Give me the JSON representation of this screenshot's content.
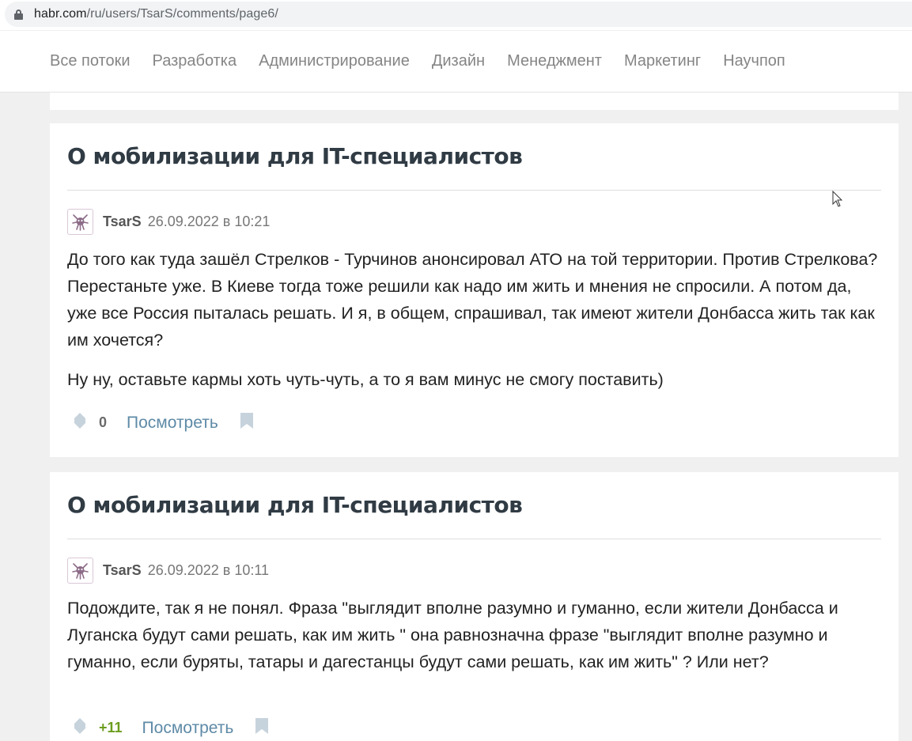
{
  "browser": {
    "url_host": "habr.com",
    "url_path": "/ru/users/TsarS/comments/page6/"
  },
  "nav": {
    "items": [
      "Все потоки",
      "Разработка",
      "Администрирование",
      "Дизайн",
      "Менеджмент",
      "Маркетинг",
      "Научпоп"
    ]
  },
  "comments": [
    {
      "post_title": "О мобилизации для IT-специалистов",
      "author": "TsarS",
      "date": "26.09.2022 в 10:21",
      "paragraphs": [
        "До того как туда зашёл Стрелков - Турчинов анонсировал АТО на той территории. Против Стрелкова? Перестаньте уже. В Киеве тогда тоже решили как надо им жить и мнения не спросили. А потом да, уже все Россия пыталась решать. И я, в общем, спрашивал, так имеют жители Донбасса жить так как им хочется?",
        "Ну ну, оставьте кармы хоть чуть-чуть, а то я вам минус не смогу поставить)"
      ],
      "score": "0",
      "view_label": "Посмотреть"
    },
    {
      "post_title": "О мобилизации для IT-специалистов",
      "author": "TsarS",
      "date": "26.09.2022 в 10:11",
      "paragraphs": [
        "Подождите, так я не понял. Фраза \"выглядит вполне разумно и гуманно, если жители Донбасса и Луганска будут сами решать, как им жить \" она равнозначна фразе \"выглядит вполне разумно и гуманно, если буряты, татары и дагестанцы будут сами решать, как им жить\" ? Или нет?"
      ],
      "score": "+11",
      "view_label": "Посмотреть"
    }
  ],
  "icons": {
    "lock": "lock-icon",
    "avatar": "avatar-icon",
    "vote": "vote-icon",
    "bookmark": "bookmark-icon",
    "cursor": "mouse-cursor-icon"
  },
  "colors": {
    "link": "#5e8aa6",
    "positive_score": "#6c9d1f",
    "title": "#303b44"
  }
}
